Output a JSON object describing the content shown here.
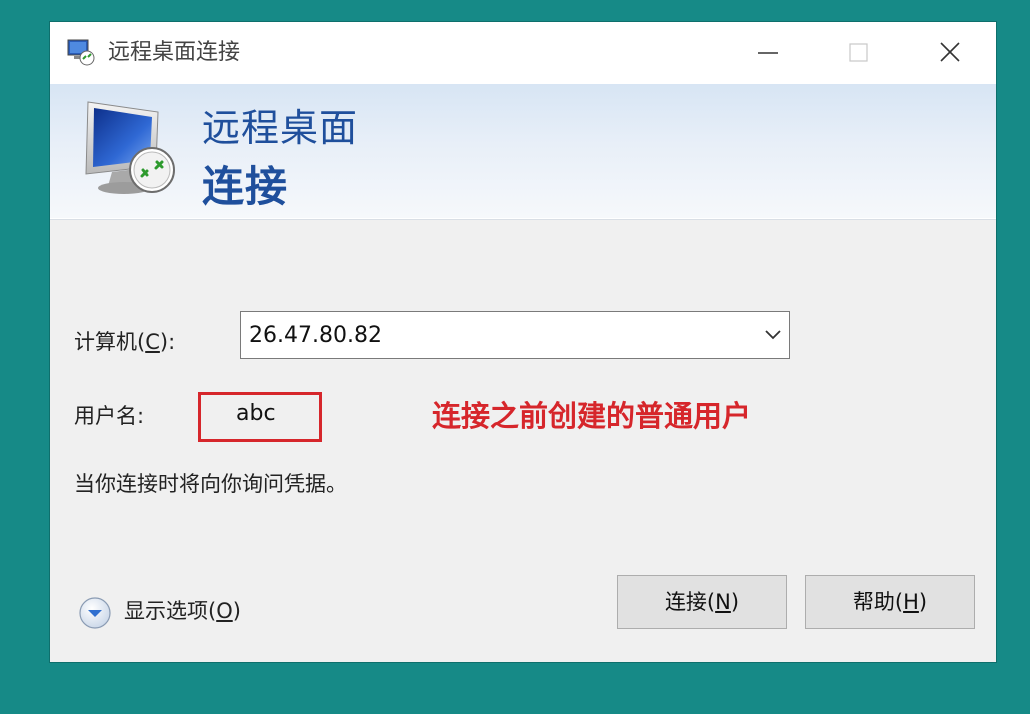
{
  "window": {
    "title": "远程桌面连接"
  },
  "banner": {
    "line1": "远程桌面",
    "line2": "连接"
  },
  "form": {
    "computer_label_pre": "计算机(",
    "computer_label_key": "C",
    "computer_label_post": "):",
    "computer_value": "26.47.80.82",
    "username_label": "用户名:",
    "username_value": "abc",
    "credentials_note": "当你连接时将向你询问凭据。"
  },
  "annotation": {
    "text": "连接之前创建的普通用户",
    "color": "#d6262b"
  },
  "options": {
    "label_pre": "显示选项(",
    "label_key": "O",
    "label_post": ")"
  },
  "buttons": {
    "connect_pre": "连接(",
    "connect_key": "N",
    "connect_post": ")",
    "help_pre": "帮助(",
    "help_key": "H",
    "help_post": ")"
  },
  "icons": {
    "title": "remote-desktop-icon",
    "banner": "remote-desktop-monitor-icon",
    "options": "expand-chevron-icon"
  },
  "colors": {
    "desktop": "#168a87",
    "banner_text": "#1f4f9c",
    "highlight": "#d6262b"
  }
}
